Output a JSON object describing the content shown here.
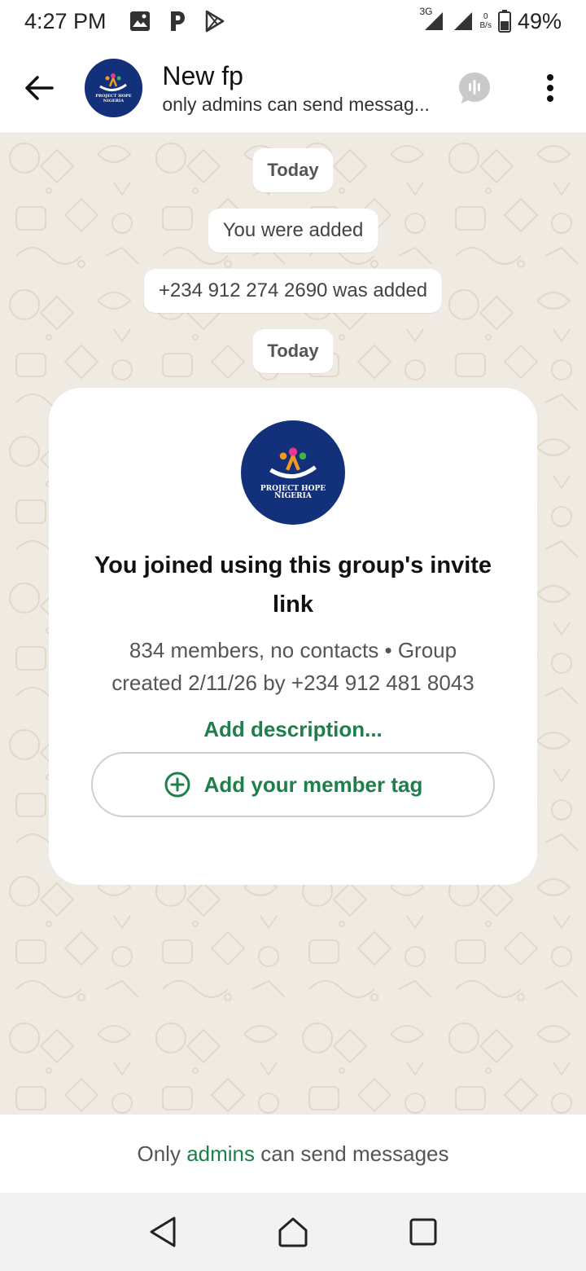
{
  "status_bar": {
    "time": "4:27 PM",
    "network": "3G",
    "data_speed_top": "0",
    "data_speed_unit": "B/s",
    "battery": "49%",
    "icons": [
      "gallery-icon",
      "p-app-icon",
      "play-store-icon",
      "signal-icon",
      "battery-icon"
    ]
  },
  "header": {
    "title": "New fp",
    "subtitle": "only admins can send messag...",
    "avatar_logo_line1": "PROJECT HOPE",
    "avatar_logo_line2": "NIGERIA"
  },
  "chat": {
    "system_messages": [
      "Today",
      "You were added",
      "+234 912 274 2690 was added",
      "Today"
    ]
  },
  "group_card": {
    "logo_line1": "PROJECT HOPE",
    "logo_line2": "NIGERIA",
    "title": "You joined using this group's invite link",
    "meta": "834 members, no contacts • Group created 2/11/26 by +234 912 481 8043",
    "add_description": "Add description...",
    "member_tag_button": "Add your member tag"
  },
  "footer": {
    "prefix": "Only ",
    "link": "admins",
    "suffix": " can send messages"
  },
  "colors": {
    "accent_green": "#1e7f4a",
    "chat_background": "#efeae2",
    "logo_navy": "#13307a"
  }
}
